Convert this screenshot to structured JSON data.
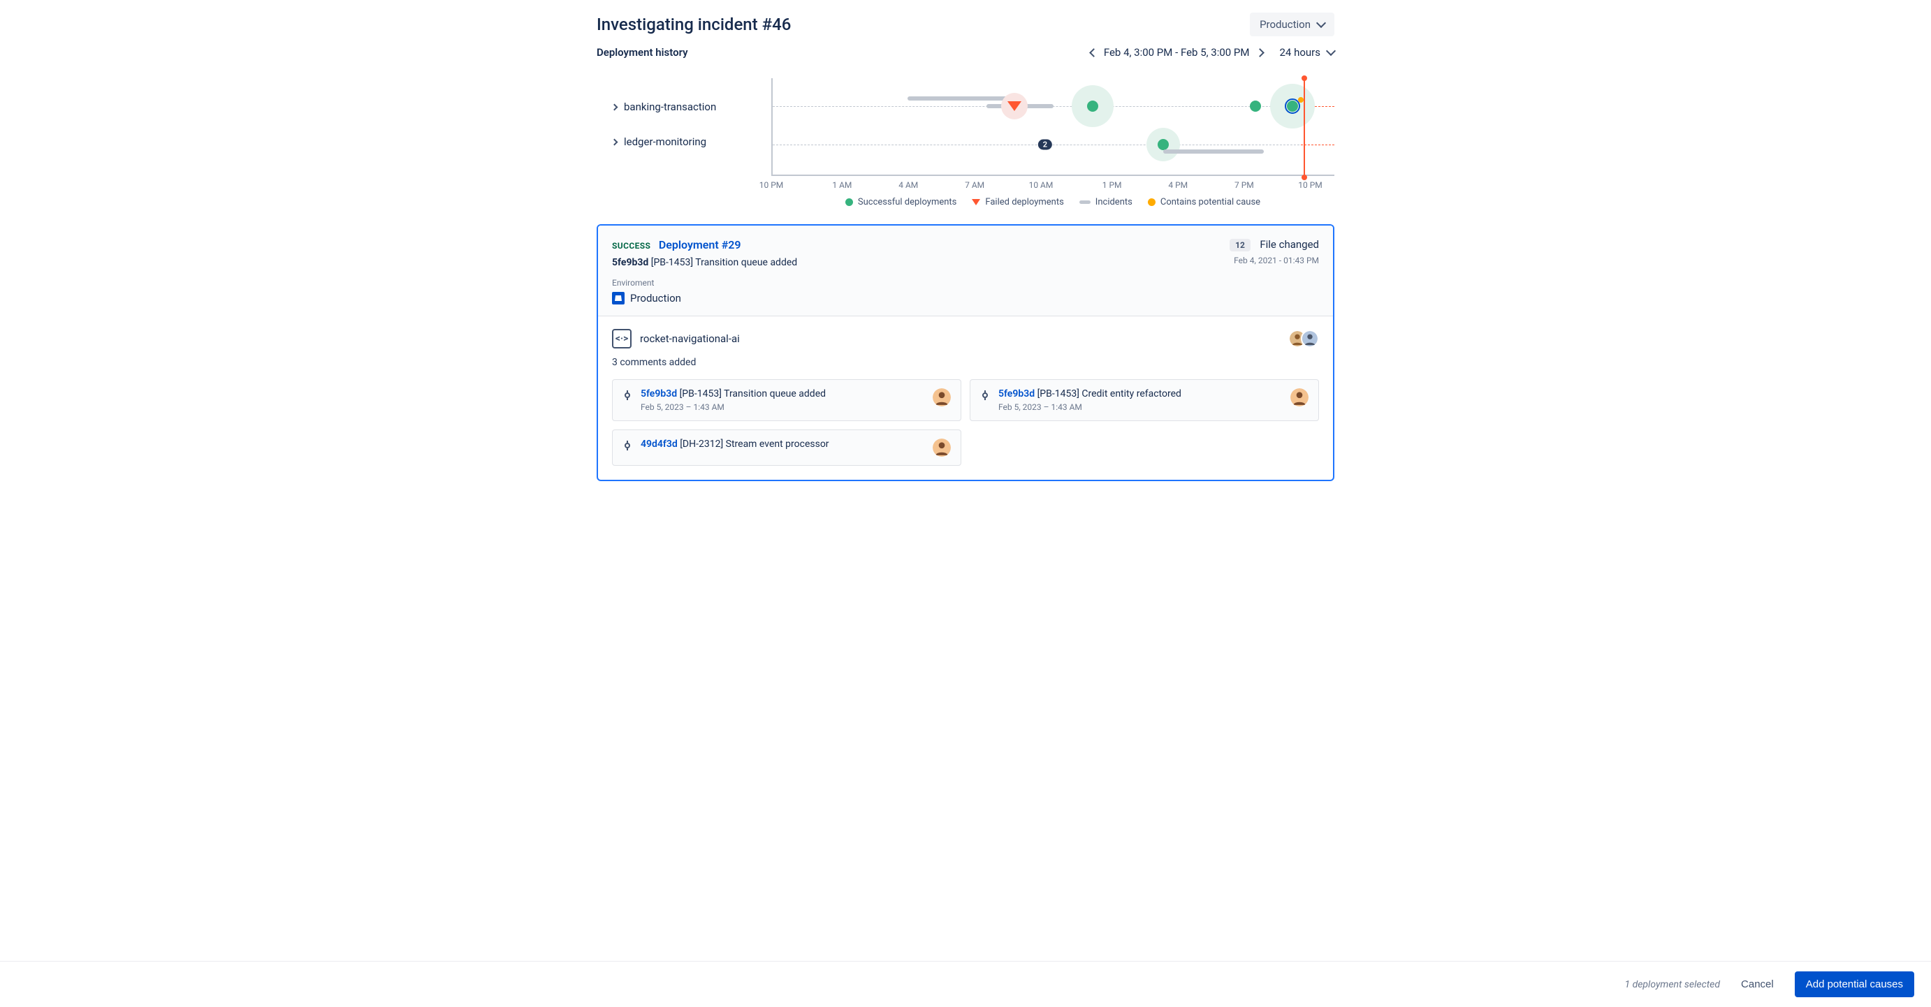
{
  "header": {
    "title": "Investigating incident #46",
    "environment_selector": "Production"
  },
  "subheader": {
    "title": "Deployment history",
    "date_range": "Feb 4, 3:00 PM - Feb 5, 3:00 PM",
    "range_selector": "24 hours"
  },
  "timeline": {
    "rows": [
      {
        "label": "banking-transaction"
      },
      {
        "label": "ledger-monitoring"
      }
    ],
    "x_ticks": [
      "10 PM",
      "1 AM",
      "4 AM",
      "7 AM",
      "10 AM",
      "1 PM",
      "4 PM",
      "7 PM",
      "10 PM"
    ],
    "cluster_count": "2",
    "legend": {
      "success": "Successful deployments",
      "failed": "Failed deployments",
      "incidents": "Incidents",
      "cause": "Contains potential cause"
    }
  },
  "chart_data": {
    "type": "timeline",
    "x_range_hours": [
      -2,
      22
    ],
    "x_ticks_hours": [
      -2,
      1,
      4,
      7,
      10,
      13,
      16,
      19,
      22
    ],
    "tracks": [
      {
        "name": "banking-transaction",
        "incidents": [
          {
            "start_h": 3.5,
            "end_h": 7.5
          },
          {
            "start_h": 7,
            "end_h": 10
          }
        ],
        "deployments": [
          {
            "hour": 8.2,
            "status": "failed",
            "halo": "small"
          },
          {
            "hour": 11.5,
            "status": "success",
            "halo": "large"
          },
          {
            "hour": 18.5,
            "status": "success",
            "halo": "none"
          },
          {
            "hour": 20.2,
            "status": "success",
            "halo": "large",
            "focused": true,
            "potential_cause": true
          }
        ]
      },
      {
        "name": "ledger-monitoring",
        "incidents": [
          {
            "start_h": 14.5,
            "end_h": 19
          }
        ],
        "deployments": [
          {
            "hour": 9.5,
            "status": "cluster",
            "count": 2
          },
          {
            "hour": 14.5,
            "status": "success",
            "halo": "medium"
          }
        ]
      }
    ],
    "now_marker_x_percent": 94
  },
  "panel": {
    "status": "SUCCESS",
    "title": "Deployment #29",
    "commit_hash": "5fe9b3d",
    "commit_msg": "[PB-1453] Transition queue added",
    "env_label": "Enviroment",
    "env_value": "Production",
    "file_count": "12",
    "file_label": "File changed",
    "timestamp": "Feb 4, 2021 - 01:43 PM",
    "repo_name": "rocket-navigational-ai",
    "comments_text": "3 comments added",
    "commits": [
      {
        "hash": "5fe9b3d",
        "msg": "[PB-1453] Transition queue added",
        "time": "Feb 5, 2023 – 1:43 AM"
      },
      {
        "hash": "5fe9b3d",
        "msg": "[PB-1453] Credit entity refactored",
        "time": "Feb 5, 2023 – 1:43 AM"
      },
      {
        "hash": "49d4f3d",
        "msg": "[DH-2312] Stream event processor",
        "time": ""
      }
    ]
  },
  "footer": {
    "selected_text": "1 deployment selected",
    "cancel": "Cancel",
    "primary": "Add potential causes"
  }
}
